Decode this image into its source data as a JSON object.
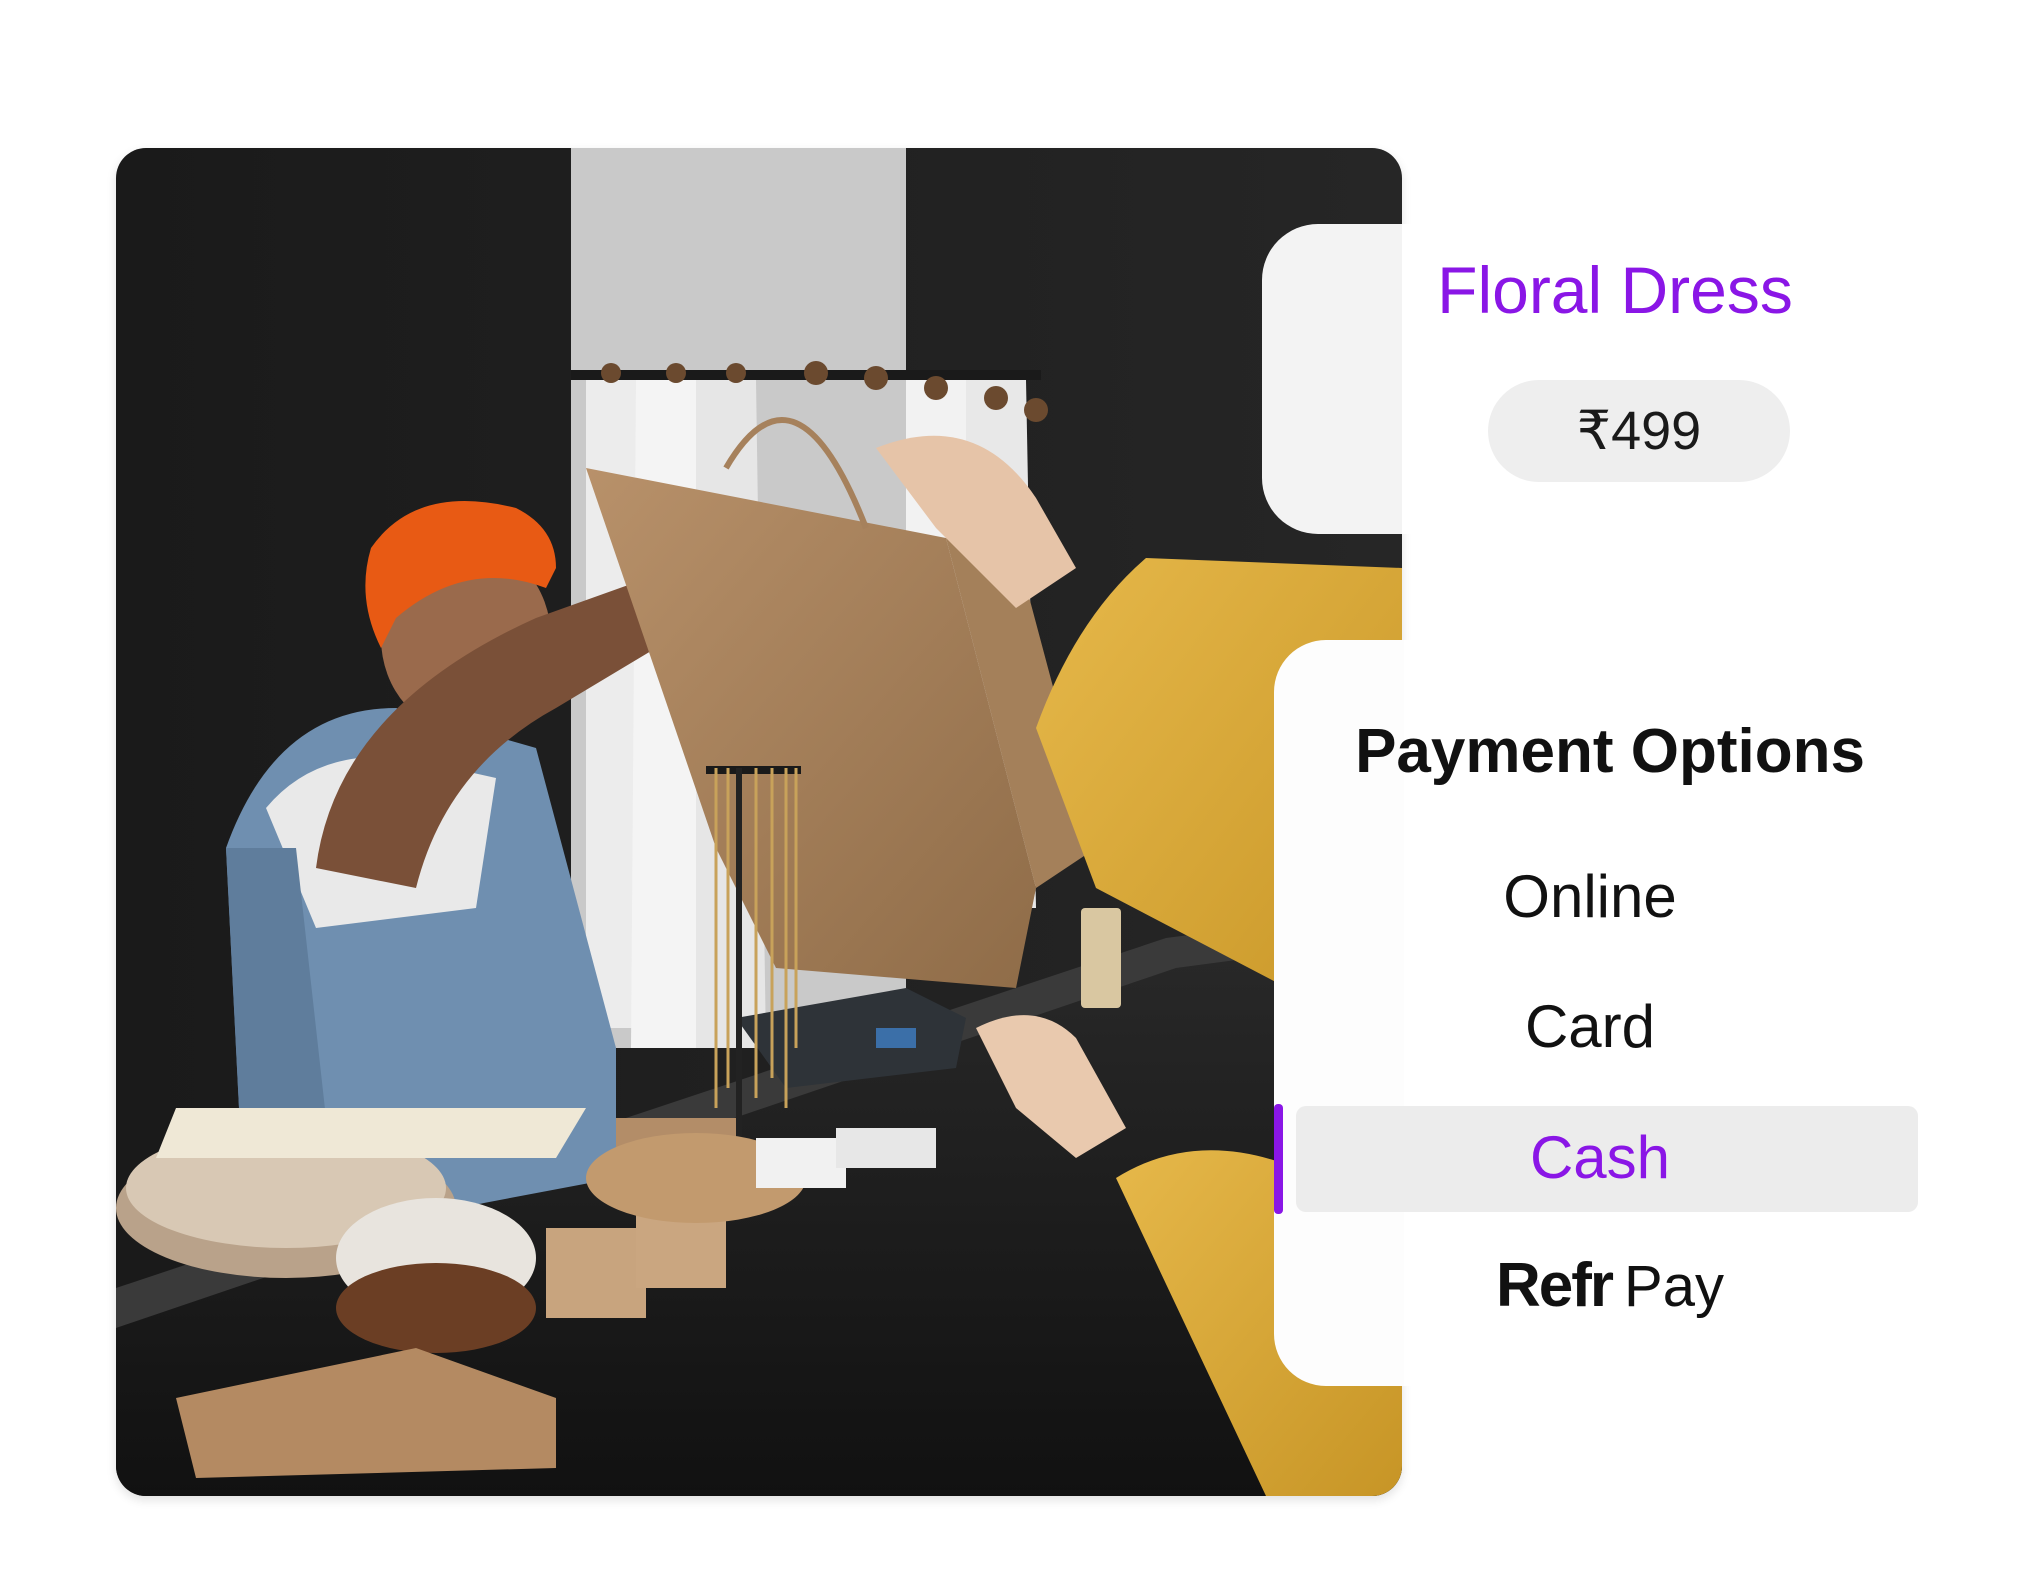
{
  "product": {
    "name": "Floral Dress",
    "price": "₹499"
  },
  "payment": {
    "title": "Payment Options",
    "options": [
      {
        "label": "Online",
        "selected": false
      },
      {
        "label": "Card",
        "selected": false
      },
      {
        "label": "Cash",
        "selected": true
      }
    ],
    "brand_option": {
      "part1": "Refr",
      "part2": "Pay"
    }
  },
  "colors": {
    "accent": "#8a16e6",
    "pill_bg": "#eeeeee",
    "panel_bg": "#f3f3f3"
  },
  "photo": {
    "icon": "shop-counter-photo"
  }
}
